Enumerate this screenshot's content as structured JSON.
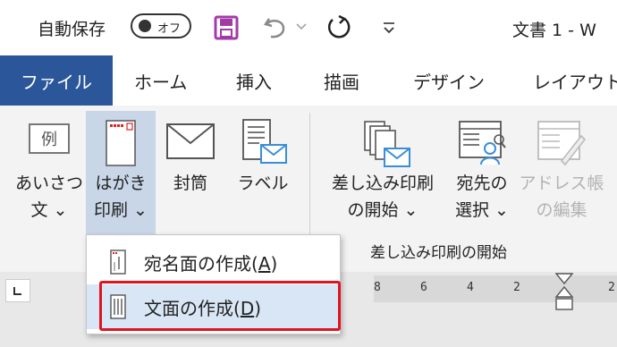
{
  "titlebar": {
    "autosave_label": "自動保存",
    "autosave_state": "オフ",
    "doc_title": "文書 1 - W",
    "icons": [
      "save-icon",
      "undo-icon",
      "undo-dropdown-icon",
      "redo-icon",
      "customize-qat-icon"
    ]
  },
  "tabs": {
    "file": "ファイル",
    "items": [
      "ホーム",
      "挿入",
      "描画",
      "デザイン",
      "レイアウト"
    ]
  },
  "ribbon": {
    "greeting": {
      "line1": "あいさつ",
      "line2": "文 ⌄",
      "icon_text": "例"
    },
    "hagaki": {
      "line1": "はがき",
      "line2": "印刷 ⌄"
    },
    "envelope": {
      "line1": "封筒"
    },
    "label": {
      "line1": "ラベル"
    },
    "start_merge": {
      "line1": "差し込み印刷",
      "line2": "の開始 ⌄"
    },
    "recipients": {
      "line1": "宛先の",
      "line2": "選択 ⌄"
    },
    "edit_list": {
      "line1": "アドレス帳",
      "line2": "の編集"
    },
    "group_label": "差し込み印刷の開始"
  },
  "dropdown": {
    "items": [
      {
        "label": "宛名面の作成(",
        "key": "A",
        "close": ")"
      },
      {
        "label": "文面の作成(",
        "key": "D",
        "close": ")"
      }
    ]
  },
  "ruler": {
    "numbers": [
      "8",
      "6",
      "4",
      "2",
      "2"
    ]
  },
  "colors": {
    "file_tab": "#2b579a",
    "highlight": "#d9e6f5",
    "callout": "#e0141e",
    "save_icon": "#a23ba8"
  }
}
